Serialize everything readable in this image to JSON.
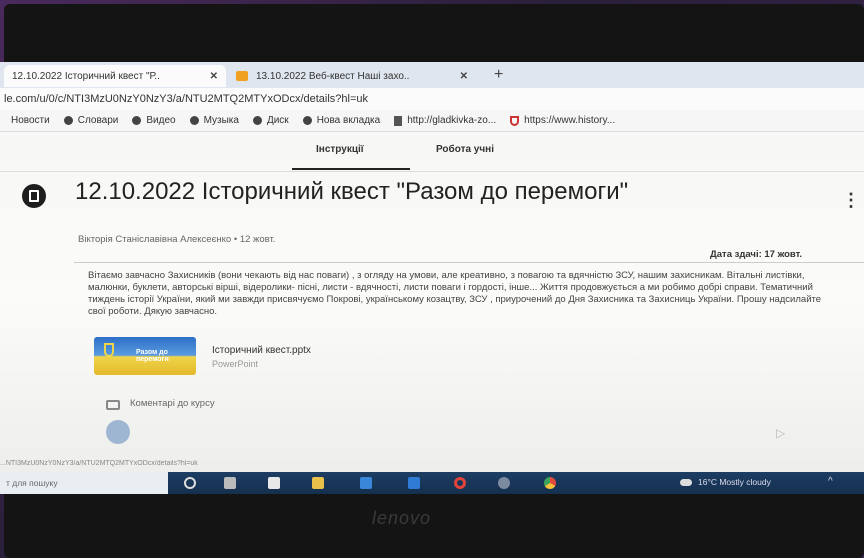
{
  "browser": {
    "tabs": [
      {
        "label": "12.10.2022 Історичний квест \"Р..",
        "close": "✕"
      },
      {
        "label": "13.10.2022 Веб-квест Наші захо..",
        "close": "✕"
      }
    ],
    "new_tab": "+",
    "url": "le.com/u/0/c/NTI3MzU0NzY0NzY3/a/NTU2MTQ2MTYxODcx/details?hl=uk",
    "bookmarks": [
      {
        "label": "Новости",
        "icon": "bookmark-icon"
      },
      {
        "label": "Словари",
        "icon": "dictionary-icon"
      },
      {
        "label": "Видео",
        "icon": "video-icon"
      },
      {
        "label": "Музыка",
        "icon": "music-icon"
      },
      {
        "label": "Диск",
        "icon": "drive-icon"
      },
      {
        "label": "Нова вкладка",
        "icon": "new-tab-icon"
      },
      {
        "label": "http://gladkivka-zo...",
        "icon": "page-icon"
      },
      {
        "label": "https://www.history...",
        "icon": "shield-icon"
      }
    ],
    "status_url": "...NTI3MzU0NzY0NzY3/a/NTU2MTQ2MTYxODcx/details?hl=uk"
  },
  "classroom": {
    "tabs": [
      "Інструкції",
      "Робота учні"
    ],
    "assignment": {
      "title": "12.10.2022 Історичний квест \"Разом до перемоги\"",
      "author": "Вікторія Станіславівна Алексеєнко • 12 жовт.",
      "due": "Дата здачі: 17 жовт.",
      "description": "Вітаємо завчасно Захисників (вони чекають від нас поваги) , з огляду на умови, але креативно, з повагою та вдячністю ЗСУ, нашим захисникам. Вітальні листівки, малюнки, буклети, авторські вірші, відеролики- пісні, листи - вдячності, листи поваги і гордості, інше... Життя продовжується а ми робимо добрі справи. Тематичний тиждень історії України, який ми завжди присвячуємо Покрові, українському козацтву, ЗСУ , приурочений до Дня Захисника та Захисниць України. Прошу надсилайте свої роботи. Дякую завчасно.",
      "attachment": {
        "name": "Історичний квест.pptx",
        "type": "PowerPoint",
        "thumb_text": "Разом до перемоги"
      },
      "comments": "Коментарі до курсу",
      "more": "⋮"
    }
  },
  "taskbar": {
    "search": "т для пошуку",
    "weather": "16°C  Mostly cloudy",
    "chevron": "^",
    "icons": [
      "start-icon",
      "task-view-icon",
      "file-icon",
      "explorer-icon",
      "store-icon",
      "mail-icon",
      "opera-icon",
      "media-icon",
      "chrome-icon"
    ]
  },
  "device_logo": "lenovo"
}
